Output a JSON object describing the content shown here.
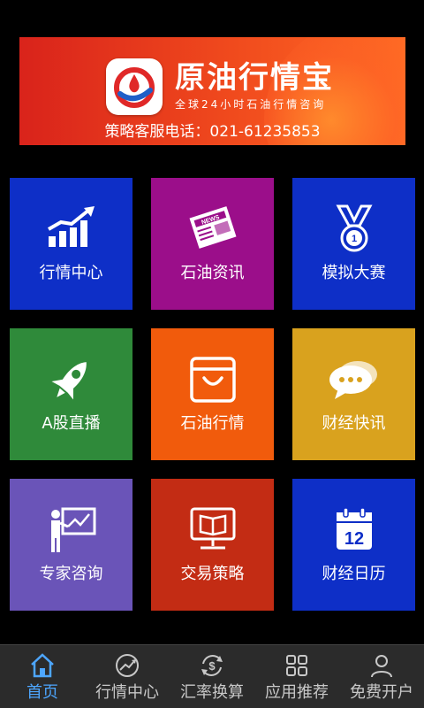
{
  "banner": {
    "app_title": "原油行情宝",
    "tagline": "全球24小时石油行情咨询",
    "hotline": "策略客服电话：021-61235853"
  },
  "tiles": [
    {
      "label": "行情中心",
      "icon": "rising-chart-icon",
      "color": "#0e2fc7"
    },
    {
      "label": "石油资讯",
      "icon": "newspaper-icon",
      "color": "#9b0e8a"
    },
    {
      "label": "模拟大赛",
      "icon": "medal-icon",
      "color": "#0e2fc7"
    },
    {
      "label": "A股直播",
      "icon": "rocket-icon",
      "color": "#2f8a3a"
    },
    {
      "label": "石油行情",
      "icon": "shopping-bag-icon",
      "color": "#f15b0c"
    },
    {
      "label": "财经快讯",
      "icon": "chat-bubbles-icon",
      "color": "#d9a21e"
    },
    {
      "label": "专家咨询",
      "icon": "presenter-board-icon",
      "color": "#6a54b8"
    },
    {
      "label": "交易策略",
      "icon": "book-monitor-icon",
      "color": "#c32c14"
    },
    {
      "label": "财经日历",
      "icon": "calendar-icon",
      "color": "#0e2fc7"
    }
  ],
  "bottom_nav": {
    "active_color": "#4da6ff",
    "items": [
      {
        "label": "首页",
        "icon": "home-icon",
        "active": true
      },
      {
        "label": "行情中心",
        "icon": "trend-circle-icon",
        "active": false
      },
      {
        "label": "汇率换算",
        "icon": "currency-exchange-icon",
        "active": false
      },
      {
        "label": "应用推荐",
        "icon": "app-grid-icon",
        "active": false
      },
      {
        "label": "免费开户",
        "icon": "user-icon",
        "active": false
      }
    ]
  },
  "calendar_day": "12"
}
